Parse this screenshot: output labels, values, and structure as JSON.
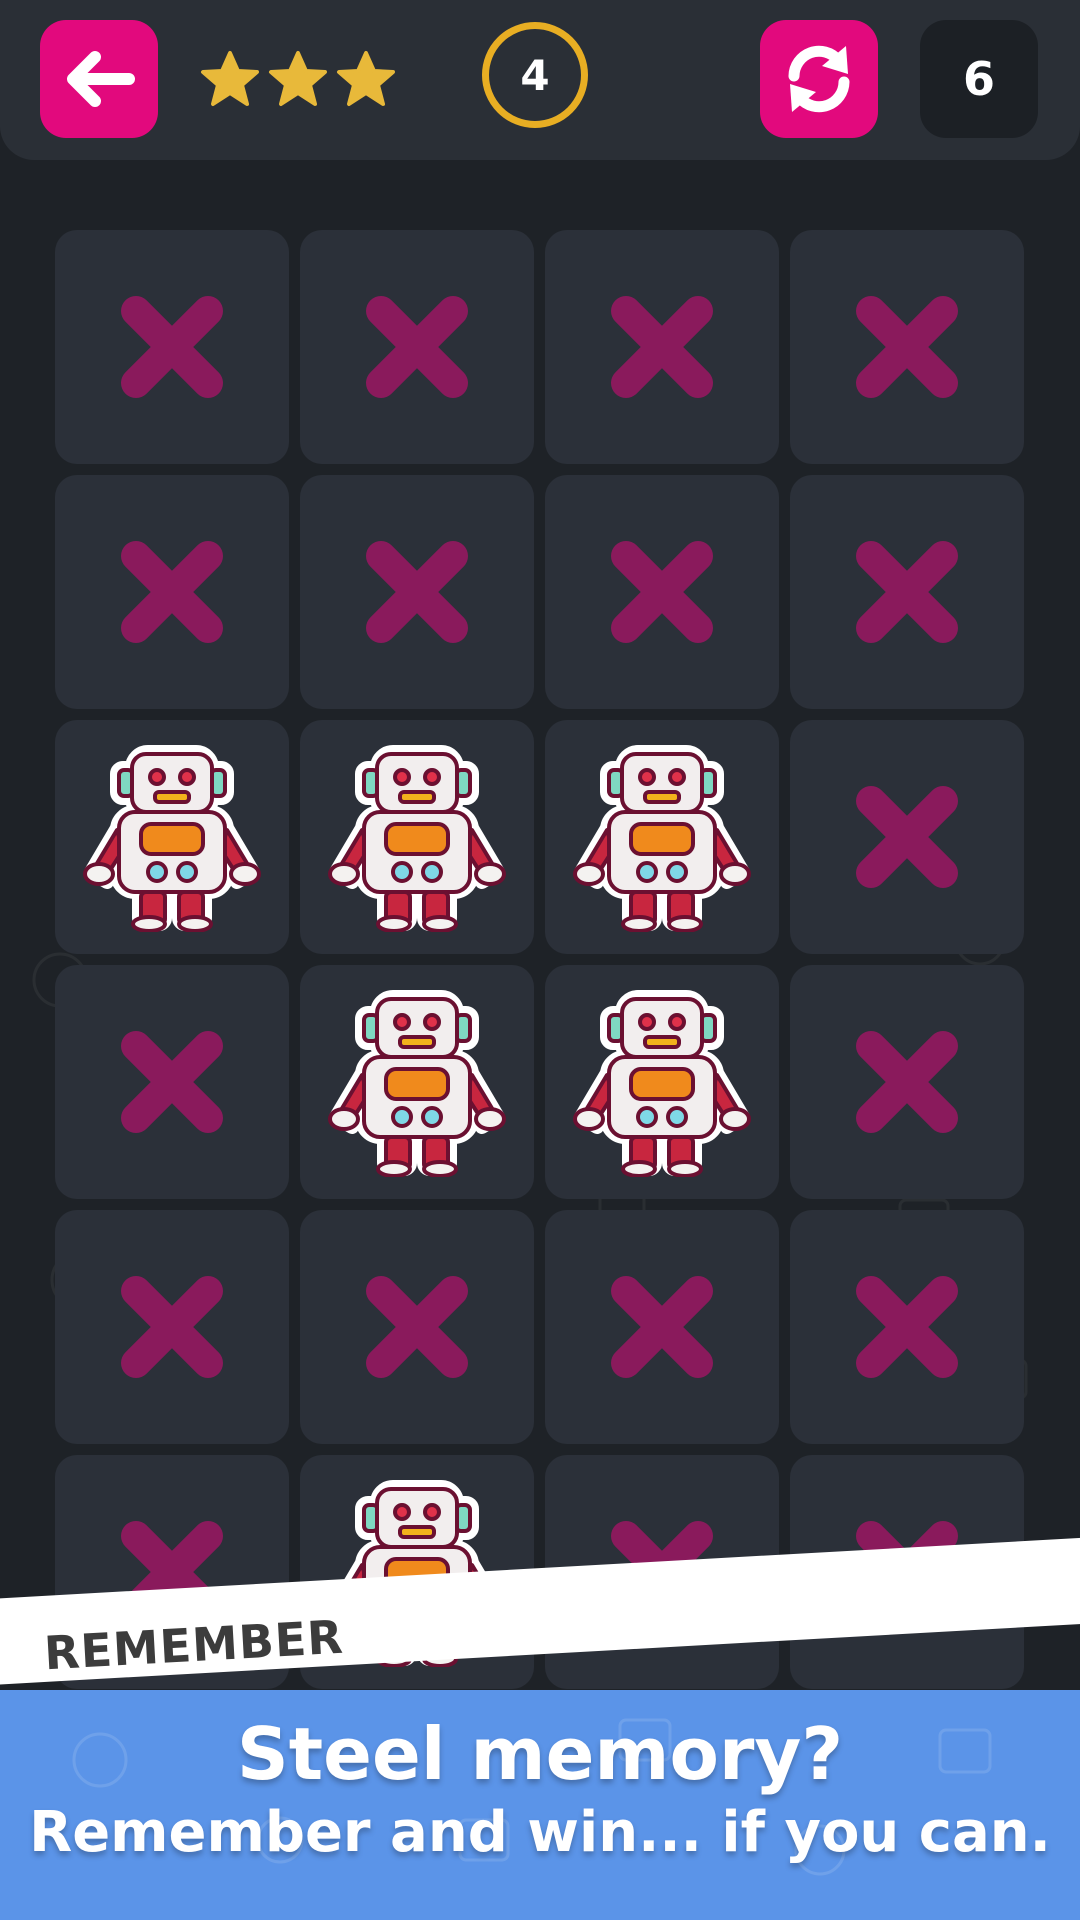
{
  "header": {
    "back_icon": "arrow-left-icon",
    "stars_earned": 3,
    "stars_total": 3,
    "level": "4",
    "restart_icon": "refresh-icon",
    "moves": "6"
  },
  "board": {
    "columns": 4,
    "visible_rows": 6,
    "tiles": [
      "cross",
      "cross",
      "cross",
      "cross",
      "cross",
      "cross",
      "cross",
      "cross",
      "robot",
      "robot",
      "robot",
      "cross",
      "cross",
      "robot",
      "robot",
      "cross",
      "cross",
      "cross",
      "cross",
      "cross",
      "cross",
      "robot",
      "cross",
      "cross"
    ]
  },
  "banner": {
    "ribbon_label": "REMEMBER",
    "headline": "Steel memory?",
    "subline": "Remember and win... if you can."
  },
  "colors": {
    "accent_pink": "#e2097d",
    "cross": "#8a1a5c",
    "star": "#e8b93a",
    "level_ring": "#e8ae23",
    "banner_blue": "#5b94e8",
    "background": "#1e2227",
    "tile": "#2b3039"
  }
}
